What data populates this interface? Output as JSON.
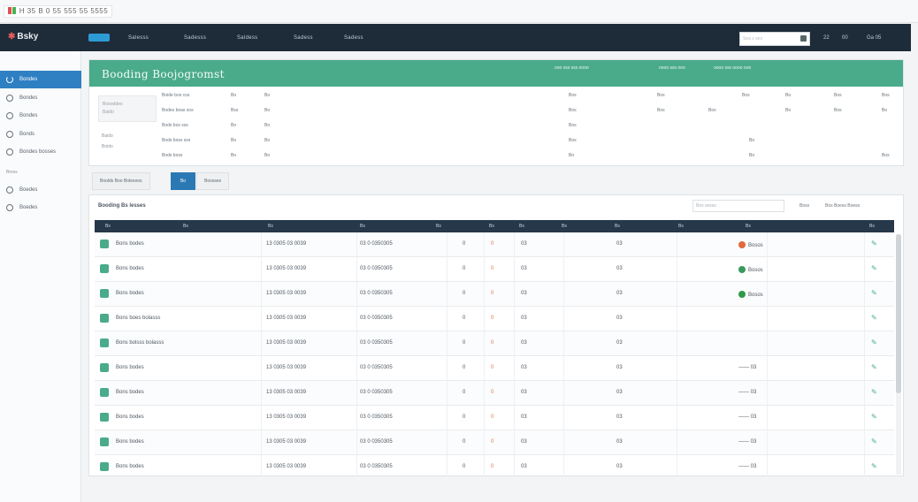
{
  "browser": {
    "title": "H 35 B   0 55 555 55 5555"
  },
  "navbar": {
    "brand": "Bsky",
    "items": [
      "Salesss",
      "Sadesss",
      "Saldess",
      "Sadess",
      "Sadess"
    ],
    "search_placeholder": "Sea s ses",
    "right": [
      "22",
      "00",
      "Ga 05"
    ]
  },
  "sidebar": {
    "items": [
      "Bondes",
      "Bondes",
      "Bondes",
      "Bonds",
      "Bondes bosses"
    ],
    "section": "Bress",
    "items2": [
      "Boedes",
      "Boedes"
    ]
  },
  "panel": {
    "title": "Booding Boojogromst",
    "header_stats": [
      "ooo sss sss oooo",
      "oooo sss ooo",
      "oooo sss oooo ooo"
    ],
    "left_box_lines": [
      "Boooddes",
      "Baido"
    ],
    "left_labels": [
      "Baido",
      "Boido"
    ],
    "fields": [
      [
        "Boide bos cos",
        "Bo",
        "Bo"
      ],
      [
        "Bodes boas sos",
        "Bss",
        "Bo"
      ],
      [
        "Bods bos sss",
        "Bo",
        "Bo"
      ],
      [
        "Bods boss sss",
        "Bo",
        "Bo"
      ],
      [
        "Bods boss",
        "Bo",
        "Bo"
      ]
    ],
    "right_fields": [
      [
        "Bos",
        "Bos",
        "Bos",
        "Bo",
        "Bos",
        "Bos"
      ],
      [
        "Bos",
        "Bos",
        "Bos",
        "Bo",
        "Bos",
        "Bo"
      ],
      [
        "Bos"
      ],
      [
        "Bos",
        "Bo"
      ],
      [
        "Bo",
        "Bo",
        "Bos"
      ]
    ]
  },
  "filters": {
    "a": "Boolds Boo Bolesoos",
    "b": "Bo",
    "c": "Boosses"
  },
  "table": {
    "title": "Booding Bs lesses",
    "search_placeholder": "Bos sesss",
    "controls": [
      "Boss",
      "Bos Boess Boess"
    ],
    "headers": [
      "Bs",
      "Bs",
      "Bs",
      "Bs",
      "Bs",
      "Bs",
      "Bs",
      "Bs",
      "Bs",
      "Bs",
      "Bs",
      "Bs"
    ],
    "rows": [
      {
        "name": "Bons bodes",
        "date": "13 0305 03 0039",
        "code": "03 0 0350305",
        "a": "0",
        "b": "0",
        "c": "03",
        "d": "03",
        "status": "Bosos",
        "dot": "#e06a3c"
      },
      {
        "name": "Bons bodes",
        "date": "13 0305 03 0039",
        "code": "03 0 0350305",
        "a": "0",
        "b": "0",
        "c": "03",
        "d": "03",
        "status": "Bosos",
        "dot": "#3a9a5c"
      },
      {
        "name": "Bons bodes",
        "date": "13 0305 03 0039",
        "code": "03 0 0350305",
        "a": "0",
        "b": "0",
        "c": "03",
        "d": "03",
        "status": "Bosos",
        "dot": "#2f9a48"
      },
      {
        "name": "Bons boes bolasss",
        "date": "13 0305 03 0039",
        "code": "03 0 0350305",
        "a": "0",
        "b": "0",
        "c": "03",
        "d": "03",
        "status": "",
        "dot": ""
      },
      {
        "name": "Bons bolsss bolasss",
        "date": "13 0305 03 0039",
        "code": "03 0 0350305",
        "a": "0",
        "b": "0",
        "c": "03",
        "d": "03",
        "status": "",
        "dot": ""
      },
      {
        "name": "Bons bodes",
        "date": "13 0305 03 0039",
        "code": "03 0 0350305",
        "a": "0",
        "b": "0",
        "c": "03",
        "d": "03",
        "status": "—— 03",
        "dot": ""
      },
      {
        "name": "Bons bodes",
        "date": "13 0305 03 0039",
        "code": "03 0 0350305",
        "a": "0",
        "b": "0",
        "c": "03",
        "d": "03",
        "status": "—— 03",
        "dot": ""
      },
      {
        "name": "Bons bodes",
        "date": "13 0305 03 0039",
        "code": "03 0 0350305",
        "a": "0",
        "b": "0",
        "c": "03",
        "d": "03",
        "status": "—— 03",
        "dot": ""
      },
      {
        "name": "Bons bodes",
        "date": "13 0305 03 0039",
        "code": "03 0 0350305",
        "a": "0",
        "b": "0",
        "c": "03",
        "d": "03",
        "status": "—— 03",
        "dot": ""
      },
      {
        "name": "Bons bodes",
        "date": "13 0305 03 0039",
        "code": "03 0 0350305",
        "a": "0",
        "b": "0",
        "c": "03",
        "d": "03",
        "status": "—— 03",
        "dot": ""
      }
    ]
  },
  "colors": {
    "nav": "#1e2b38",
    "accent": "#4aab8a",
    "primary": "#2f7fc3",
    "table_head": "#26384a"
  }
}
